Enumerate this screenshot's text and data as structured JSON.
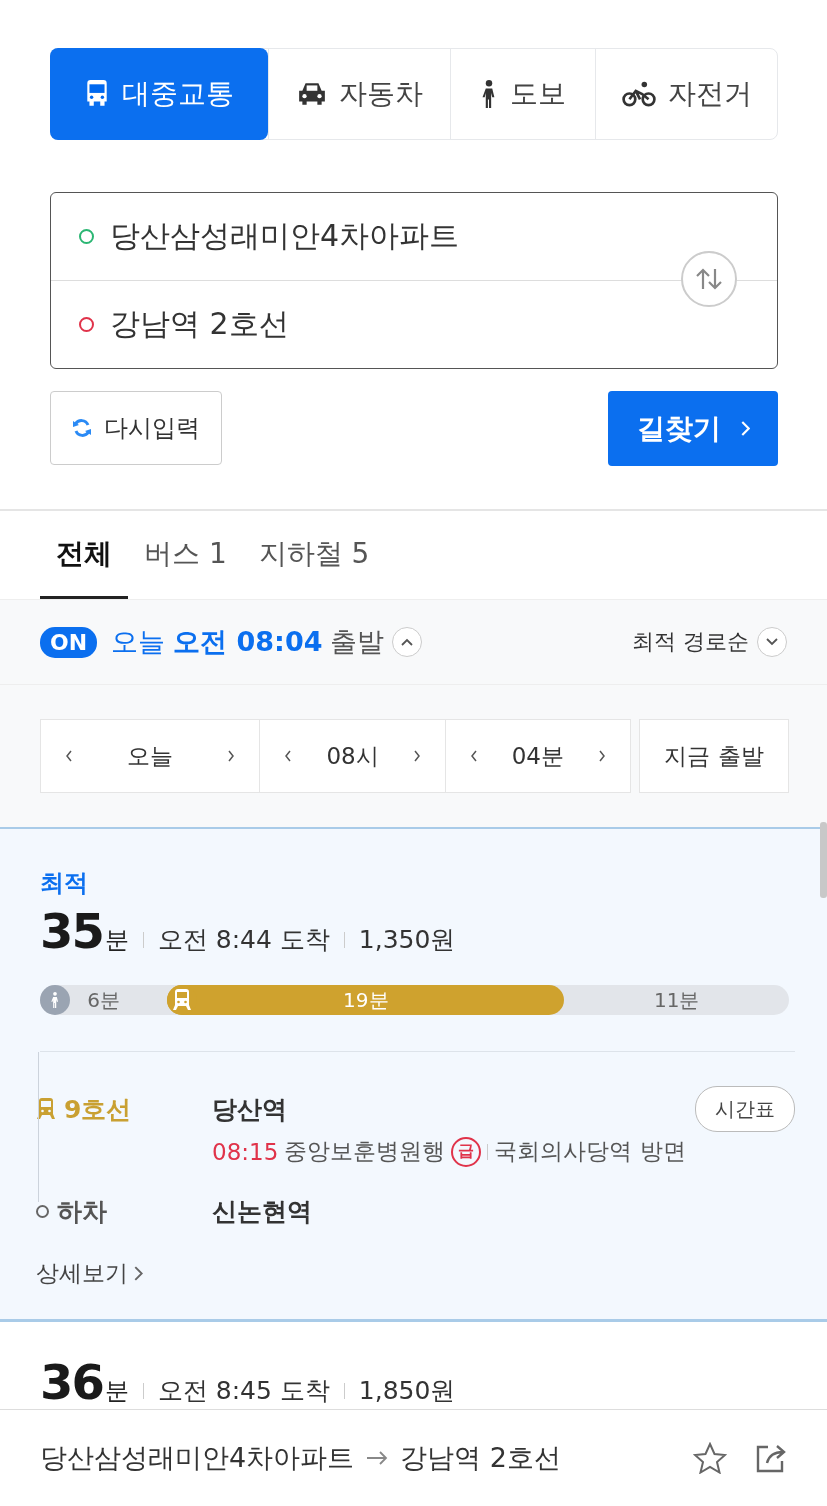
{
  "mode_tabs": [
    {
      "kind": "transit",
      "label": "대중교통",
      "selected": true
    },
    {
      "kind": "car",
      "label": "자동차",
      "selected": false
    },
    {
      "kind": "walk",
      "label": "도보",
      "selected": false
    },
    {
      "kind": "bike",
      "label": "자전거",
      "selected": false
    }
  ],
  "route": {
    "origin": "당산삼성래미안4차아파트",
    "destination": "강남역 2호선"
  },
  "reset_button": "다시입력",
  "search_button": "길찾기",
  "result_tabs": [
    {
      "label": "전체",
      "selected": true
    },
    {
      "label": "버스 1",
      "selected": false
    },
    {
      "label": "지하철 5",
      "selected": false
    }
  ],
  "departure": {
    "badge": "ON",
    "day": "오늘",
    "time": "오전 08:04",
    "suffix": "출발",
    "sort": "최적 경로순"
  },
  "time_picker": {
    "day": "오늘",
    "hour": "08시",
    "minute": "04분",
    "now_button": "지금 출발"
  },
  "results": [
    {
      "badge": "최적",
      "selected": true,
      "minutes": "35",
      "unit": "분",
      "arrival": "오전 8:44 도착",
      "fare": "1,350원",
      "segments": [
        {
          "kind": "walk",
          "label": "6분"
        },
        {
          "kind": "subway",
          "label": "19분"
        },
        {
          "kind": "walk",
          "label": "11분"
        }
      ],
      "board": {
        "line": "9호선",
        "station": "당산역",
        "timetable_button": "시간표",
        "departure_time": "08:15",
        "bound": "중앙보훈병원행",
        "express": "급",
        "direction": "국회의사당역 방면"
      },
      "alight": {
        "label": "하차",
        "station": "신논현역"
      },
      "detail_link": "상세보기"
    },
    {
      "selected": false,
      "minutes": "36",
      "unit": "분",
      "arrival": "오전 8:45 도착",
      "fare": "1,850원"
    }
  ],
  "footer": {
    "origin": "당산삼성래미안4차아파트",
    "destination": "강남역 2호선"
  }
}
